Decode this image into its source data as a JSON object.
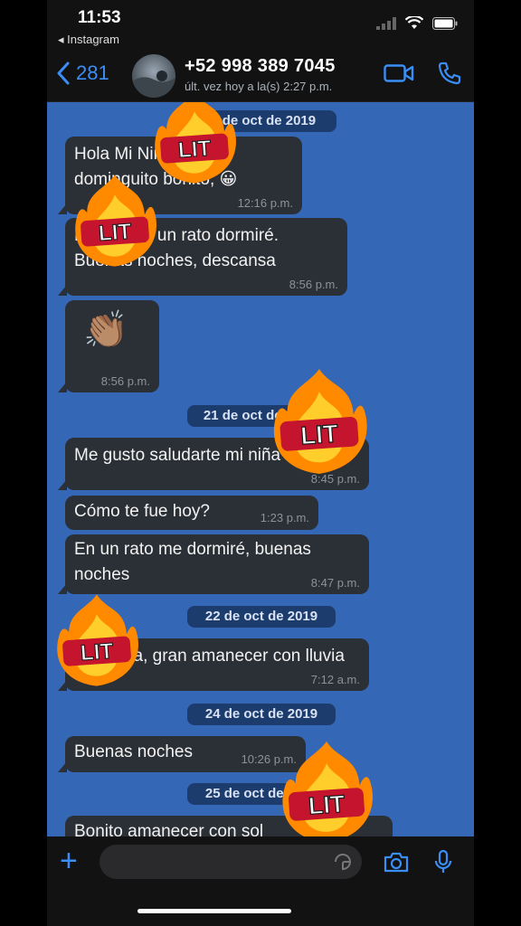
{
  "status_bar": {
    "time": "11:53",
    "back_app": "◂ Instagram"
  },
  "header": {
    "back_count": "281",
    "contact_name": "+52 998 389 7045",
    "last_seen": "últ. vez hoy a la(s) 2:27 p.m."
  },
  "sticker_text": "LIT",
  "dates": [
    "20 de oct de 2019",
    "21 de oct de 2019",
    "22 de oct de 2019",
    "24 de oct de 2019",
    "25 de oct de 2019"
  ],
  "messages": [
    {
      "text": "Hola Mi Niña, bonito\ndominguito bonito, 😀",
      "time": "12:16 p.m."
    },
    {
      "text": "Bueno, en un rato dormiré.\nBuenas noches, descansa",
      "time": "8:56 p.m."
    },
    {
      "text": "👏🏽",
      "time": "8:56 p.m."
    },
    {
      "text": "Me gusto saludarte mi niña",
      "time": "8:45 p.m."
    },
    {
      "text": "Cómo te fue hoy?",
      "time": "1:23 p.m."
    },
    {
      "text": "En un rato me dormiré, buenas\nnoches",
      "time": "8:47 p.m."
    },
    {
      "text": "Buen día, gran amanecer con lluvia",
      "time": "7:12 a.m."
    },
    {
      "text": "Buenas noches",
      "time": "10:26 p.m."
    },
    {
      "text": "Bonito amanecer con sol",
      "time": ""
    }
  ],
  "colors": {
    "chat_bg": "#3567b7",
    "bubble": "#2b2f36",
    "accent": "#3a8ef5"
  }
}
